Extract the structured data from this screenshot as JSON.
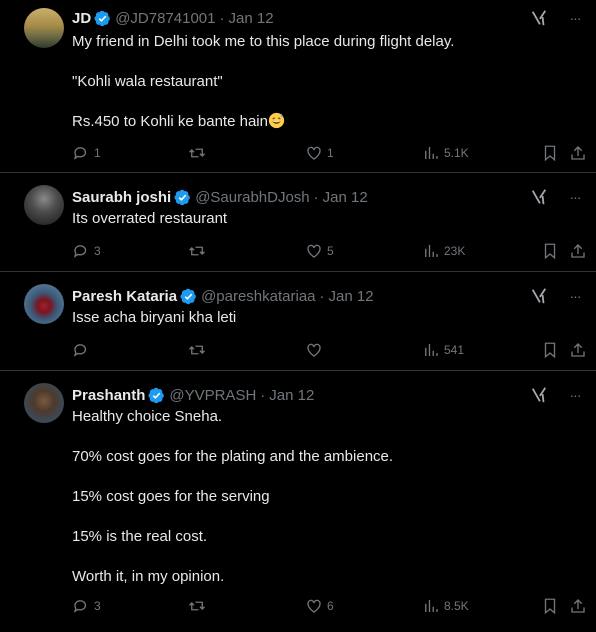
{
  "tweets": [
    {
      "name": "JD",
      "handle": "@JD78741001",
      "dot": "·",
      "date": "Jan 12",
      "lines": [
        "My friend in Delhi took me to this place during flight delay.",
        "\"Kohli wala restaurant\"",
        "Rs.450 to Kohli ke bante hain"
      ],
      "replies": "1",
      "retweets": "",
      "likes": "1",
      "views": "5.1K"
    },
    {
      "name": "Saurabh joshi",
      "handle": "@SaurabhDJosh",
      "dot": "·",
      "date": "Jan 12",
      "lines": [
        "Its overrated restaurant"
      ],
      "replies": "3",
      "retweets": "",
      "likes": "5",
      "views": "23K"
    },
    {
      "name": "Paresh Kataria",
      "handle": "@pareshkatariaa",
      "dot": "·",
      "date": "Jan 12",
      "lines": [
        "Isse acha biryani kha leti"
      ],
      "replies": "",
      "retweets": "",
      "likes": "",
      "views": "541"
    },
    {
      "name": "Prashanth",
      "handle": "@YVPRASH",
      "dot": "·",
      "date": "Jan 12",
      "lines": [
        "Healthy choice Sneha.",
        "70% cost goes for the plating and the ambience.",
        "15% cost goes for the serving",
        "15% is the real cost.",
        "Worth it, in my opinion."
      ],
      "replies": "3",
      "retweets": "",
      "likes": "6",
      "views": "8.5K"
    }
  ],
  "icons": {
    "more": "···",
    "grok": "grok-icon",
    "verified": "verified-badge-icon",
    "reply": "reply-icon",
    "retweet": "retweet-icon",
    "like": "heart-icon",
    "views": "views-icon",
    "bookmark": "bookmark-icon",
    "share": "share-icon",
    "emoji": "grinning-sweat-emoji"
  },
  "colors": {
    "background": "#000000",
    "text": "#e7e9ea",
    "secondary": "#71767b",
    "verified": "#1d9bf0",
    "divider": "#2f3336"
  }
}
